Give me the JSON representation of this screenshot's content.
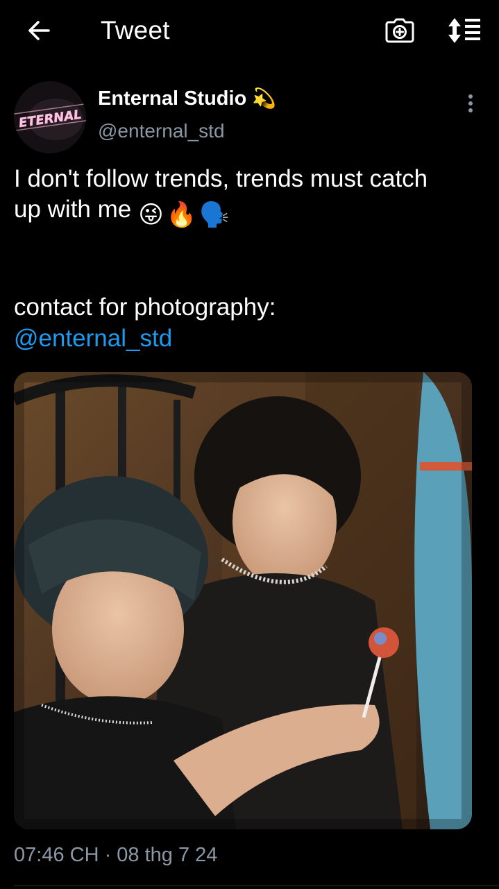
{
  "header": {
    "title": "Tweet",
    "back_icon": "arrow-left-icon",
    "camera_icon": "camera-plus-icon",
    "sort_icon": "sort-list-icon"
  },
  "tweet": {
    "author": {
      "display_name": "Enternal Studio",
      "name_emoji": "💫",
      "handle": "@enternal_std",
      "avatar_text": "ETERNAL"
    },
    "text_line1": "I don't follow trends, trends must catch",
    "text_line2": "up with me",
    "text_emojis": [
      "😜",
      "🔥",
      "🗣️"
    ],
    "contact_line": "contact for photography:",
    "mention": "@enternal_std",
    "timestamp": "07:46 CH · 08 thg 7 24"
  },
  "colors": {
    "background": "#000000",
    "text": "#ffffff",
    "secondary_text": "#8b98a5",
    "link": "#1d9bf0"
  }
}
